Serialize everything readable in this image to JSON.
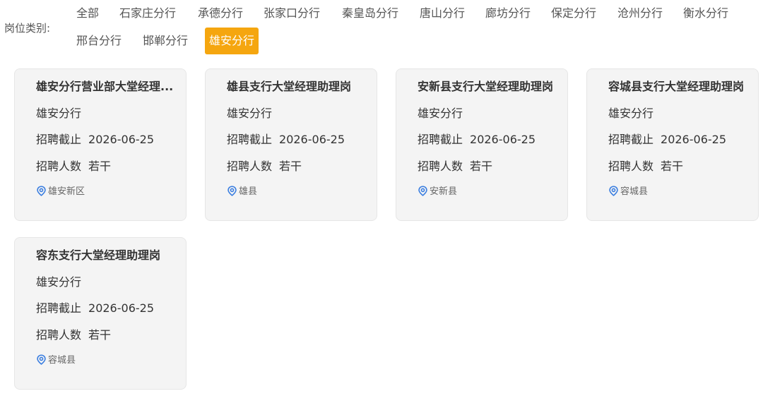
{
  "filter": {
    "label": "岗位类别:",
    "items": [
      {
        "label": "全部",
        "active": false
      },
      {
        "label": "石家庄分行",
        "active": false
      },
      {
        "label": "承德分行",
        "active": false
      },
      {
        "label": "张家口分行",
        "active": false
      },
      {
        "label": "秦皇岛分行",
        "active": false
      },
      {
        "label": "唐山分行",
        "active": false
      },
      {
        "label": "廊坊分行",
        "active": false
      },
      {
        "label": "保定分行",
        "active": false
      },
      {
        "label": "沧州分行",
        "active": false
      },
      {
        "label": "衡水分行",
        "active": false
      },
      {
        "label": "邢台分行",
        "active": false
      },
      {
        "label": "邯郸分行",
        "active": false
      },
      {
        "label": "雄安分行",
        "active": true
      }
    ]
  },
  "colors": {
    "accent": "#f5a60f",
    "location_icon": "#3c7fe0"
  },
  "card_labels": {
    "deadline": "招聘截止",
    "headcount": "招聘人数"
  },
  "cards": [
    {
      "title": "雄安分行营业部大堂经理...",
      "branch": "雄安分行",
      "deadline": "2026-06-25",
      "headcount": "若干",
      "location": "雄安新区",
      "icon": "location-pin-icon"
    },
    {
      "title": "雄县支行大堂经理助理岗",
      "branch": "雄安分行",
      "deadline": "2026-06-25",
      "headcount": "若干",
      "location": "雄县",
      "icon": "location-pin-icon"
    },
    {
      "title": "安新县支行大堂经理助理岗",
      "branch": "雄安分行",
      "deadline": "2026-06-25",
      "headcount": "若干",
      "location": "安新县",
      "icon": "location-pin-icon"
    },
    {
      "title": "容城县支行大堂经理助理岗",
      "branch": "雄安分行",
      "deadline": "2026-06-25",
      "headcount": "若干",
      "location": "容城县",
      "icon": "location-pin-icon"
    },
    {
      "title": "容东支行大堂经理助理岗",
      "branch": "雄安分行",
      "deadline": "2026-06-25",
      "headcount": "若干",
      "location": "容城县",
      "icon": "location-pin-icon"
    }
  ]
}
